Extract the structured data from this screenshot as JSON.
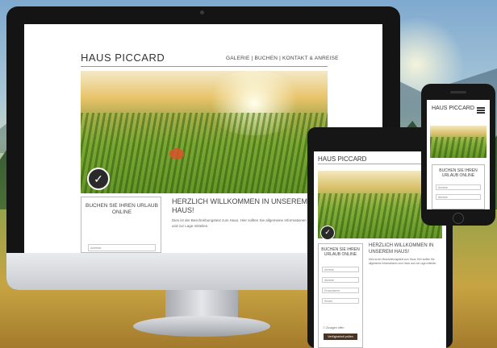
{
  "site": {
    "title": "HAUS PICCARD",
    "nav": "GALERIE | BUCHEN | KONTAKT & ANREISE",
    "welcome_heading": "HERZLICH WILLKOMMEN IN UNSEREM HAUS!",
    "welcome_text": "Dies ist der Beschreibungstext zum Haus. Hier sollten Sie allgemeine Informationen zum Haus und zur Lage mitteilen.",
    "booking_title": "BUCHEN SIE IHREN URLAUB ONLINE",
    "booking_field": "Anreise"
  },
  "tablet": {
    "title": "HAUS PICCARD",
    "welcome_heading": "HERZLICH WILLKOMMEN IN UNSEREM HAUS!",
    "welcome_text": "Dies ist der Beschreibungstext zum Haus. Hier sollten Sie allgemeine Informationen zum Haus und zur Lage mitteilen.",
    "booking_title": "BUCHEN SIE IHREN URLAUB ONLINE",
    "fields": [
      "Anreise",
      "Abreise",
      "Erwachsene",
      "Kinder"
    ],
    "checkbox_label": "Zusagen offen",
    "submit_label": "Verfügbarkeit prüfen"
  },
  "phone": {
    "title": "HAUS PICCARD",
    "booking_title": "BUCHEN SIE IHREN URLAUB ONLINE",
    "fields": [
      "Anreise",
      "Abreise"
    ]
  },
  "icons": {
    "badge": "checkmark-seal-icon",
    "menu": "hamburger-menu-icon"
  }
}
